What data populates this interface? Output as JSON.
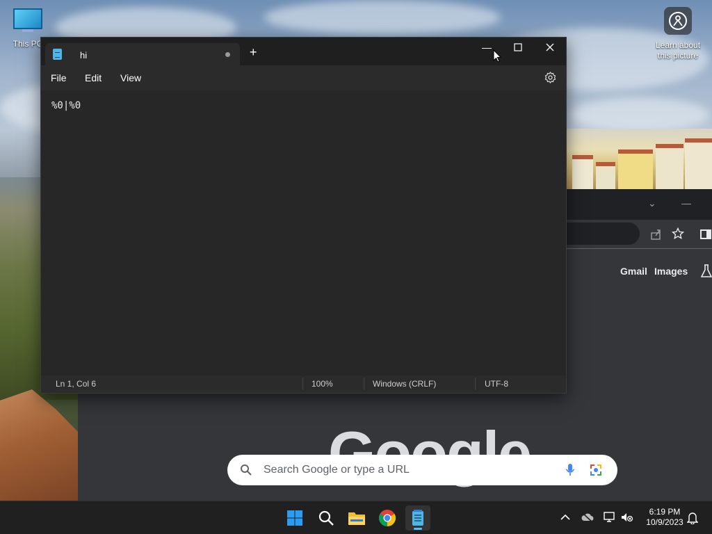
{
  "desktop": {
    "icons": [
      {
        "label": "This PC"
      },
      {
        "label": "Learn about this picture"
      }
    ]
  },
  "notepad": {
    "tab_title": "hi",
    "menu": [
      "File",
      "Edit",
      "View"
    ],
    "content": "%0|%0",
    "status": {
      "position": "Ln 1, Col 6",
      "zoom": "100%",
      "line_endings": "Windows (CRLF)",
      "encoding": "UTF-8"
    }
  },
  "chrome": {
    "links": [
      "Gmail",
      "Images"
    ],
    "logo_text": "Google",
    "search_placeholder": "Search Google or type a URL"
  },
  "taskbar": {
    "time": "6:19 PM",
    "date": "10/9/2023",
    "apps": [
      "start-icon",
      "search-icon",
      "file-explorer-icon",
      "chrome-icon",
      "notepad-icon"
    ]
  },
  "colors": {
    "accent": "#4cc2ff",
    "notepad_bg": "#272727",
    "taskbar_bg": "#202020"
  }
}
